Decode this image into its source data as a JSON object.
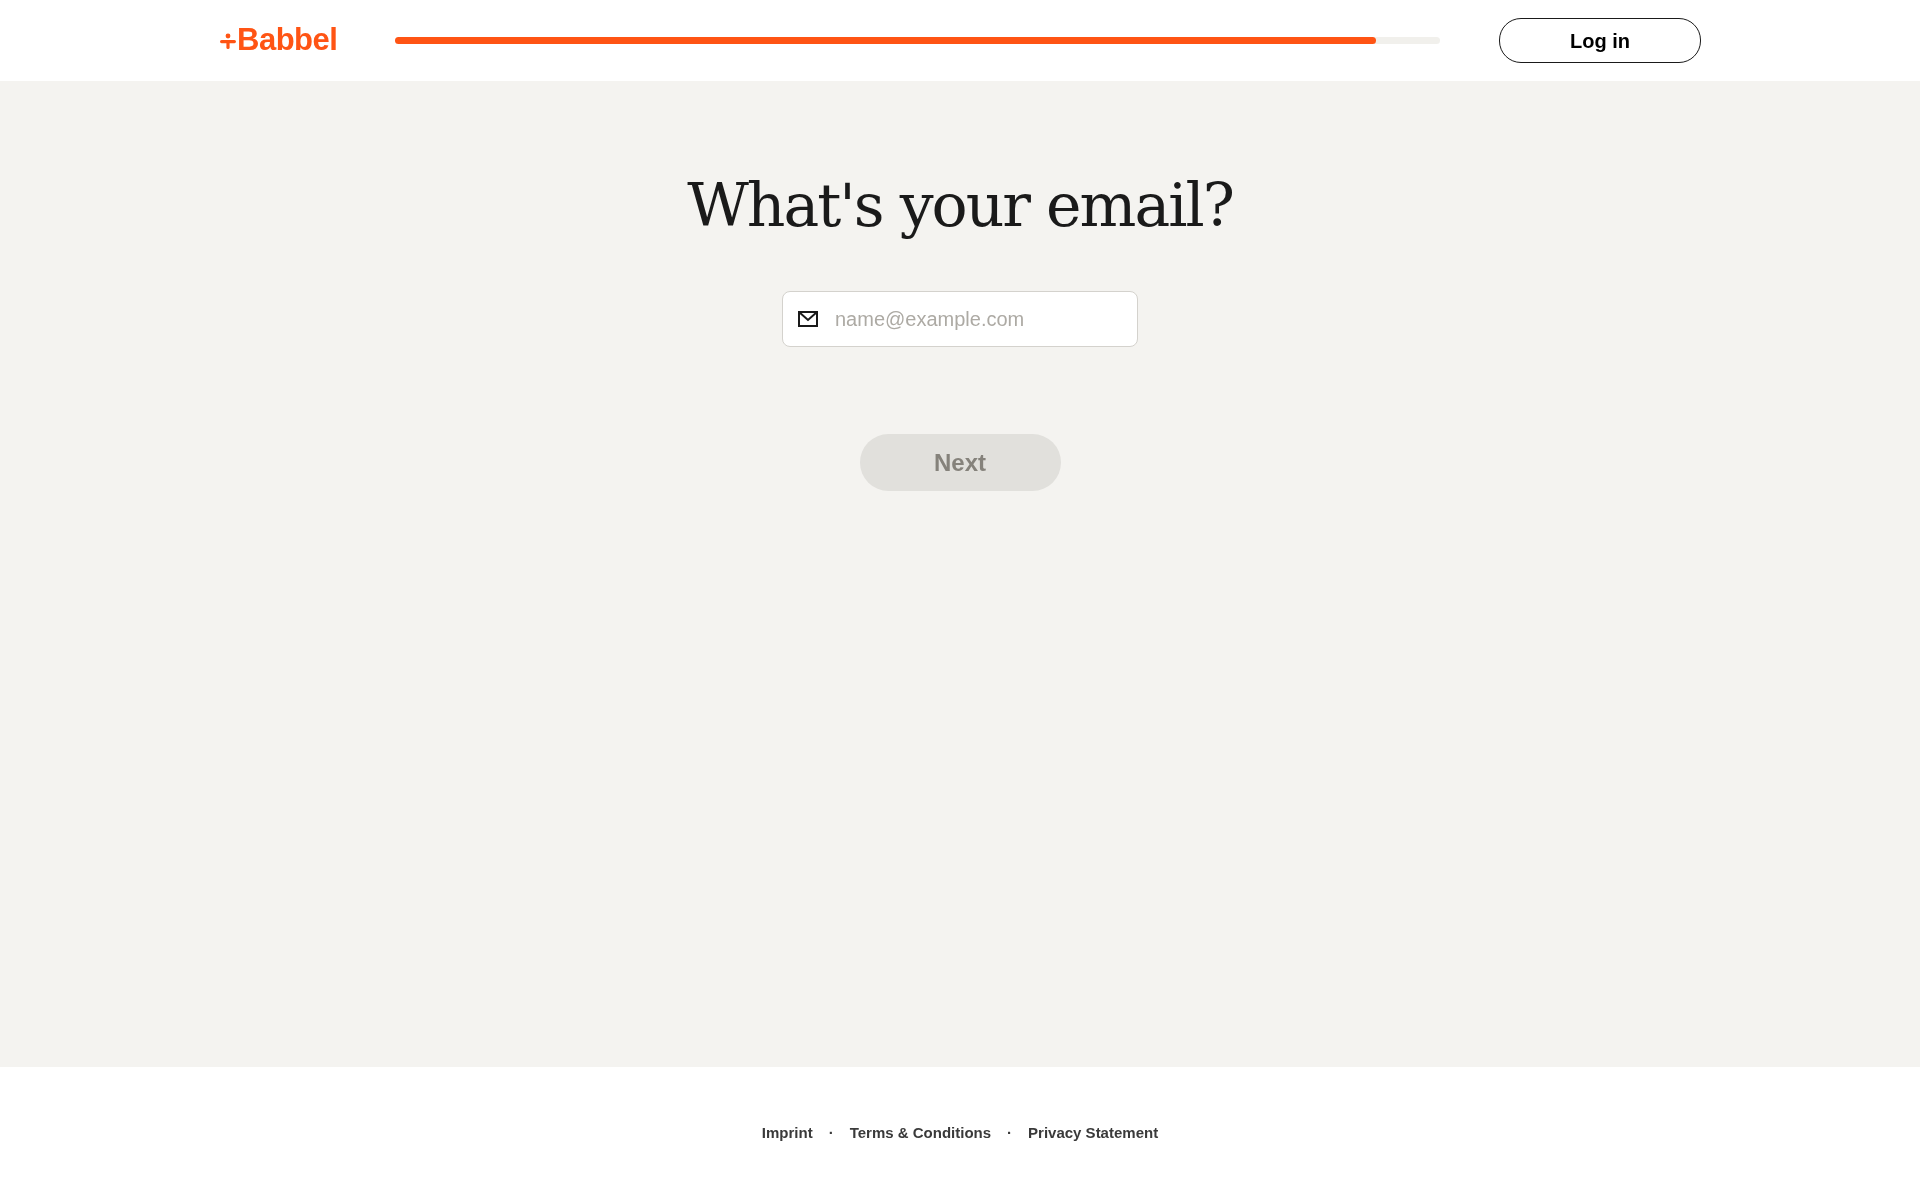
{
  "header": {
    "logo": "Babbel",
    "progress": {
      "level": 0.938
    },
    "login_button": "Log in"
  },
  "main": {
    "title": "What's your email?",
    "email_field": {
      "placeholder": "name@example.com"
    },
    "next_button": {
      "label": "Next",
      "disabled": true
    }
  },
  "footer": {
    "separator": "·",
    "links": [
      "Imprint",
      "Terms & Conditions",
      "Privacy Statement"
    ]
  }
}
